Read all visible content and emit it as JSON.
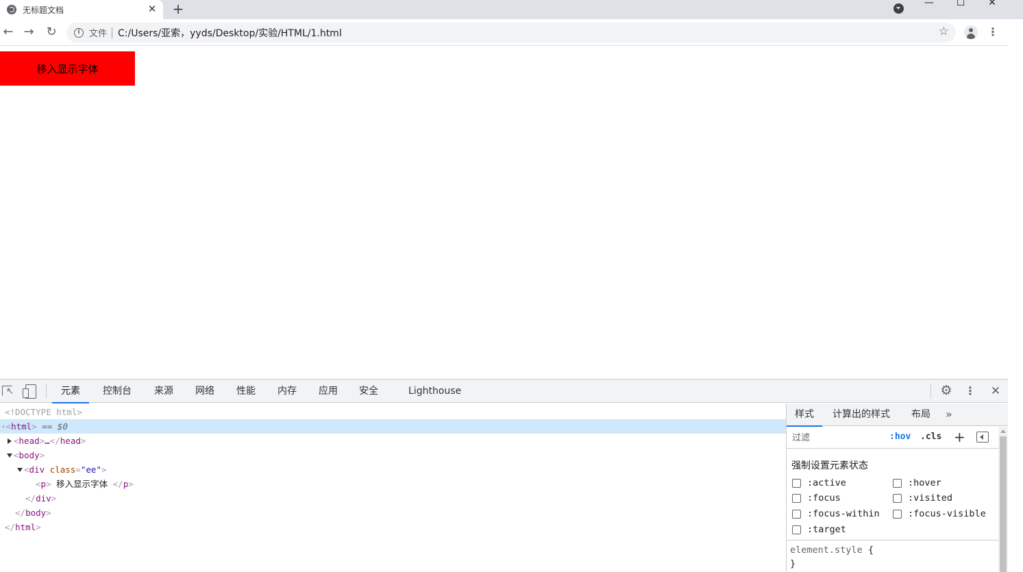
{
  "browser": {
    "tab": {
      "title": "无标题文档",
      "close_glyph": "✕"
    },
    "new_tab_glyph": "+",
    "window_controls": {
      "minimize": "—",
      "maximize": "☐",
      "close": "✕"
    },
    "nav": {
      "back": "←",
      "forward": "→",
      "reload": "↻"
    },
    "omnibox": {
      "info_glyph": "i",
      "chip": "文件",
      "url": "C:/Users/亚索，yyds/Desktop/实验/HTML/1.html",
      "star_glyph": "☆"
    },
    "menu_glyph": "⋮"
  },
  "page": {
    "hover_box_text": "移入显示字体",
    "hover_box_color": "#ff0000"
  },
  "devtools": {
    "tabs": [
      "元素",
      "控制台",
      "来源",
      "网络",
      "性能",
      "内存",
      "应用",
      "安全",
      "Lighthouse"
    ],
    "active_tab": "元素",
    "settings_glyph": "⚙",
    "menu_glyph": "⋮",
    "close_glyph": "✕",
    "tree": {
      "doctype": "<!DOCTYPE html>",
      "html_open": "html",
      "selected_marker": "== $0",
      "head": "head",
      "head_ellipsis": "…",
      "body": "body",
      "div": "div",
      "div_attr": "class",
      "div_attr_value": "\"ee\"",
      "p": "p",
      "p_text": " 移入显示字体 ",
      "div_close": "div",
      "body_close": "body",
      "html_close": "html"
    },
    "styles": {
      "tabs": [
        "样式",
        "计算出的样式",
        "布局"
      ],
      "active_tab": "样式",
      "more_glyph": "»",
      "filter_placeholder": "过滤",
      "hov": ":hov",
      "cls": ".cls",
      "plus_glyph": "+",
      "force_state_title": "强制设置元素状态",
      "states": [
        ":active",
        ":hover",
        ":focus",
        ":visited",
        ":focus-within",
        ":focus-visible",
        ":target"
      ],
      "element_style_selector": "element.style",
      "open_brace": "{",
      "close_brace": "}"
    }
  }
}
